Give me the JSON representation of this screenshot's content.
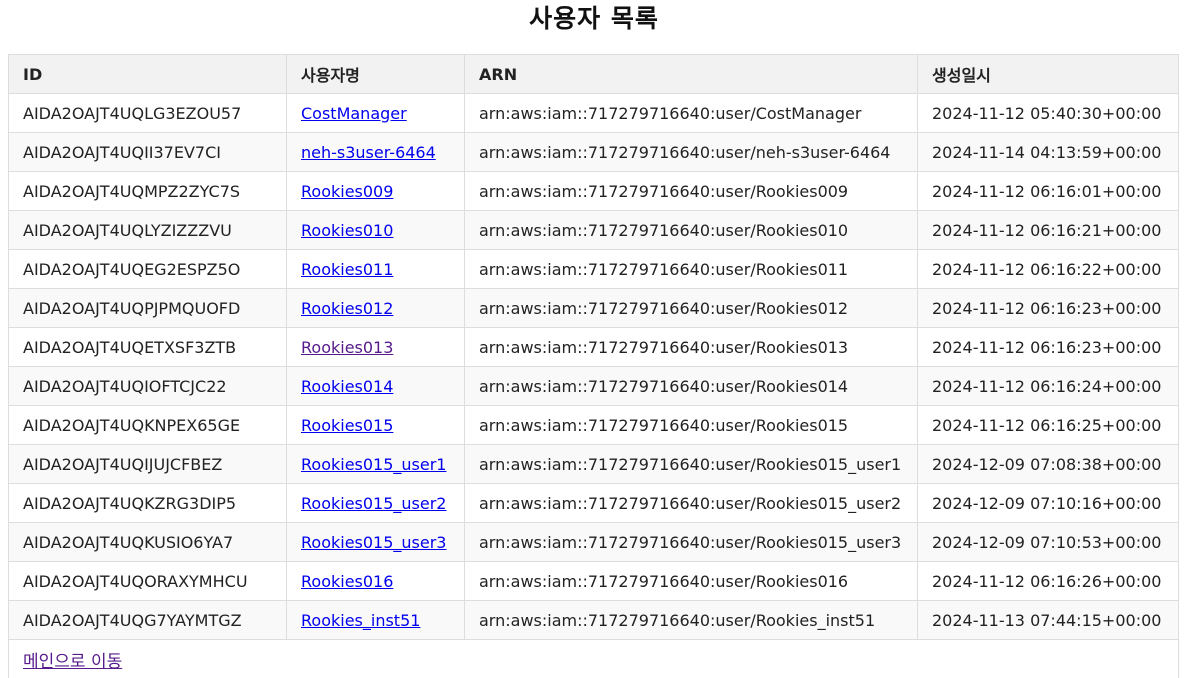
{
  "page": {
    "title": "사용자 목록",
    "main_link_label": "메인으로 이동"
  },
  "table": {
    "headers": {
      "id": "ID",
      "name": "사용자명",
      "arn": "ARN",
      "created": "생성일시"
    },
    "rows": [
      {
        "id": "AIDA2OAJT4UQLG3EZOU57",
        "name": "CostManager",
        "arn": "arn:aws:iam::717279716640:user/CostManager",
        "created": "2024-11-12 05:40:30+00:00",
        "visited": false
      },
      {
        "id": "AIDA2OAJT4UQII37EV7CI",
        "name": "neh-s3user-6464",
        "arn": "arn:aws:iam::717279716640:user/neh-s3user-6464",
        "created": "2024-11-14 04:13:59+00:00",
        "visited": false
      },
      {
        "id": "AIDA2OAJT4UQMPZ2ZYC7S",
        "name": "Rookies009",
        "arn": "arn:aws:iam::717279716640:user/Rookies009",
        "created": "2024-11-12 06:16:01+00:00",
        "visited": false
      },
      {
        "id": "AIDA2OAJT4UQLYZIZZZVU",
        "name": "Rookies010",
        "arn": "arn:aws:iam::717279716640:user/Rookies010",
        "created": "2024-11-12 06:16:21+00:00",
        "visited": false
      },
      {
        "id": "AIDA2OAJT4UQEG2ESPZ5O",
        "name": "Rookies011",
        "arn": "arn:aws:iam::717279716640:user/Rookies011",
        "created": "2024-11-12 06:16:22+00:00",
        "visited": false
      },
      {
        "id": "AIDA2OAJT4UQPJPMQUOFD",
        "name": "Rookies012",
        "arn": "arn:aws:iam::717279716640:user/Rookies012",
        "created": "2024-11-12 06:16:23+00:00",
        "visited": false
      },
      {
        "id": "AIDA2OAJT4UQETXSF3ZTB",
        "name": "Rookies013",
        "arn": "arn:aws:iam::717279716640:user/Rookies013",
        "created": "2024-11-12 06:16:23+00:00",
        "visited": true
      },
      {
        "id": "AIDA2OAJT4UQIOFTCJC22",
        "name": "Rookies014",
        "arn": "arn:aws:iam::717279716640:user/Rookies014",
        "created": "2024-11-12 06:16:24+00:00",
        "visited": false
      },
      {
        "id": "AIDA2OAJT4UQKNPEX65GE",
        "name": "Rookies015",
        "arn": "arn:aws:iam::717279716640:user/Rookies015",
        "created": "2024-11-12 06:16:25+00:00",
        "visited": false
      },
      {
        "id": "AIDA2OAJT4UQIJUJCFBEZ",
        "name": "Rookies015_user1",
        "arn": "arn:aws:iam::717279716640:user/Rookies015_user1",
        "created": "2024-12-09 07:08:38+00:00",
        "visited": false
      },
      {
        "id": "AIDA2OAJT4UQKZRG3DIP5",
        "name": "Rookies015_user2",
        "arn": "arn:aws:iam::717279716640:user/Rookies015_user2",
        "created": "2024-12-09 07:10:16+00:00",
        "visited": false
      },
      {
        "id": "AIDA2OAJT4UQKUSIO6YA7",
        "name": "Rookies015_user3",
        "arn": "arn:aws:iam::717279716640:user/Rookies015_user3",
        "created": "2024-12-09 07:10:53+00:00",
        "visited": false
      },
      {
        "id": "AIDA2OAJT4UQORAXYMHCU",
        "name": "Rookies016",
        "arn": "arn:aws:iam::717279716640:user/Rookies016",
        "created": "2024-11-12 06:16:26+00:00",
        "visited": false
      },
      {
        "id": "AIDA2OAJT4UQG7YAYMTGZ",
        "name": "Rookies_inst51",
        "arn": "arn:aws:iam::717279716640:user/Rookies_inst51",
        "created": "2024-11-13 07:44:15+00:00",
        "visited": false
      }
    ]
  },
  "colors": {
    "link": "#0000ee",
    "visited_link": "#551a8b",
    "header_bg": "#f2f2f2",
    "border": "#dddddd"
  }
}
